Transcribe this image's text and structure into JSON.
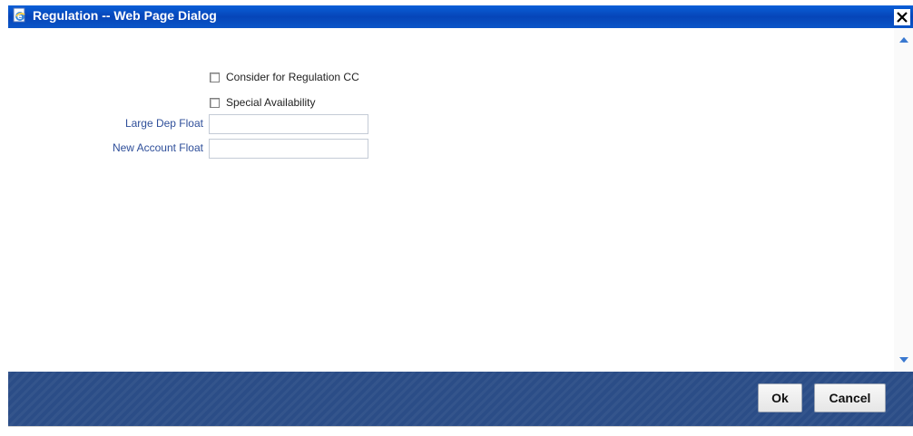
{
  "window": {
    "title": "Regulation -- Web Page Dialog",
    "close_glyph": "✕"
  },
  "form": {
    "consider_regulation_cc": {
      "label": "Consider for Regulation CC",
      "checked": false
    },
    "special_availability": {
      "label": "Special Availability",
      "checked": false
    },
    "large_dep_float": {
      "label": "Large Dep Float",
      "value": ""
    },
    "new_account_float": {
      "label": "New Account Float",
      "value": ""
    }
  },
  "footer": {
    "ok_label": "Ok",
    "cancel_label": "Cancel"
  },
  "colors": {
    "titlebar": "#0645b8",
    "footer": "#2b4d87",
    "field_label": "#2f4f9a"
  },
  "icons": [
    "ie-page-icon",
    "close-icon",
    "scroll-up-icon",
    "scroll-down-icon"
  ]
}
